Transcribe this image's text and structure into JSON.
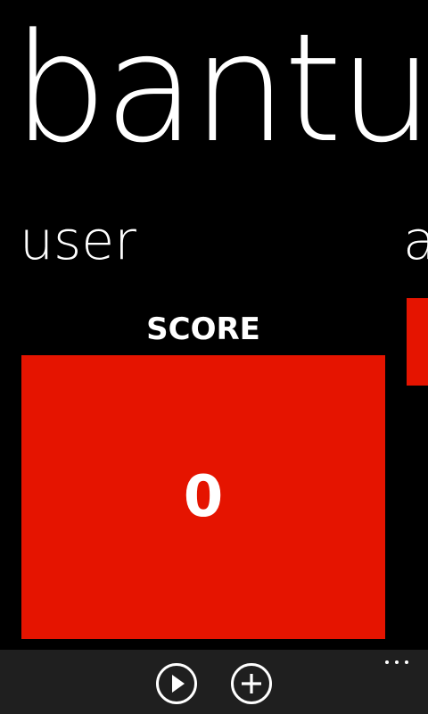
{
  "app": {
    "title": "bantu"
  },
  "pivot": {
    "current_header": "user",
    "next_header_peek": "a"
  },
  "score": {
    "label": "SCORE",
    "value": "0"
  },
  "colors": {
    "accent": "#e51400",
    "app_bar_background": "#1f1f1f",
    "background": "#000000",
    "foreground": "#ffffff"
  },
  "app_bar": {
    "buttons": [
      {
        "icon": "play-icon"
      },
      {
        "icon": "add-icon"
      }
    ],
    "more_icon": "ellipsis-icon"
  }
}
